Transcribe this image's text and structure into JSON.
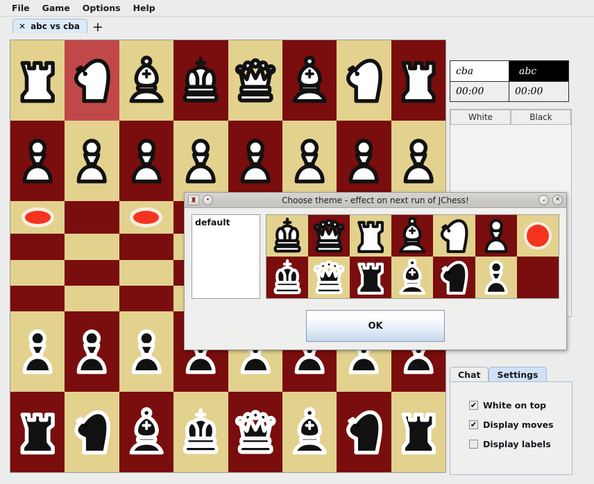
{
  "menubar": {
    "items": [
      {
        "label": "File"
      },
      {
        "label": "Game"
      },
      {
        "label": "Options"
      },
      {
        "label": "Help"
      }
    ]
  },
  "tabs": {
    "game_tab_label": "abc vs cba",
    "close_glyph": "✕",
    "add_glyph": "+"
  },
  "clocks": {
    "white_name": "cba",
    "black_name": "abc",
    "white_time": "00:00",
    "black_time": "00:00"
  },
  "movelist": {
    "col_white": "White",
    "col_black": "Black",
    "rows": []
  },
  "bottom_tabs": {
    "chat_label": "Chat",
    "settings_label": "Settings",
    "active": "Settings",
    "settings": [
      {
        "label": "White on top",
        "checked": true,
        "mark": "✔"
      },
      {
        "label": "Display moves",
        "checked": true,
        "mark": "✔"
      },
      {
        "label": "Display labels",
        "checked": false,
        "mark": ""
      }
    ]
  },
  "dialog": {
    "title": "Choose theme - effect on next run of JChess!",
    "icon_glyph": "♜",
    "menu_btn_glyph": "∙",
    "minimize_glyph": "⌄",
    "close_glyph": "✕",
    "theme_list": [
      "default"
    ],
    "selected_theme": "default",
    "ok_label": "OK",
    "preview_row_white": [
      "king",
      "queen",
      "rook",
      "bishop",
      "knight",
      "pawn",
      "marker"
    ],
    "preview_row_black": [
      "king",
      "queen",
      "rook",
      "bishop",
      "knight",
      "pawn",
      "empty"
    ]
  },
  "board": {
    "light_color": "#e2d28e",
    "dark_color": "#7a0d0d",
    "selected_color": "#c14848",
    "marker_color": "#f5341f",
    "selected_square": "b8",
    "squares": [
      [
        "w-rook",
        "w-knight",
        "w-bishop",
        "w-king",
        "w-queen",
        "w-bishop",
        "w-knight",
        "w-rook"
      ],
      [
        "w-pawn",
        "w-pawn",
        "w-pawn",
        "w-pawn",
        "w-pawn",
        "w-pawn",
        "w-pawn",
        "w-pawn"
      ],
      [
        "marker",
        "",
        "marker",
        "",
        "",
        "",
        "",
        ""
      ],
      [
        "",
        "",
        "",
        "",
        "",
        "",
        "",
        ""
      ],
      [
        "",
        "",
        "",
        "",
        "",
        "",
        "",
        ""
      ],
      [
        "",
        "",
        "",
        "",
        "",
        "",
        "",
        ""
      ],
      [
        "b-pawn",
        "b-pawn",
        "b-pawn",
        "b-pawn",
        "b-pawn",
        "b-pawn",
        "b-pawn",
        "b-pawn"
      ],
      [
        "b-rook",
        "b-knight",
        "b-bishop",
        "b-king",
        "b-queen",
        "b-bishop",
        "b-knight",
        "b-rook"
      ]
    ],
    "highlighted": [
      [
        0,
        1
      ]
    ]
  }
}
